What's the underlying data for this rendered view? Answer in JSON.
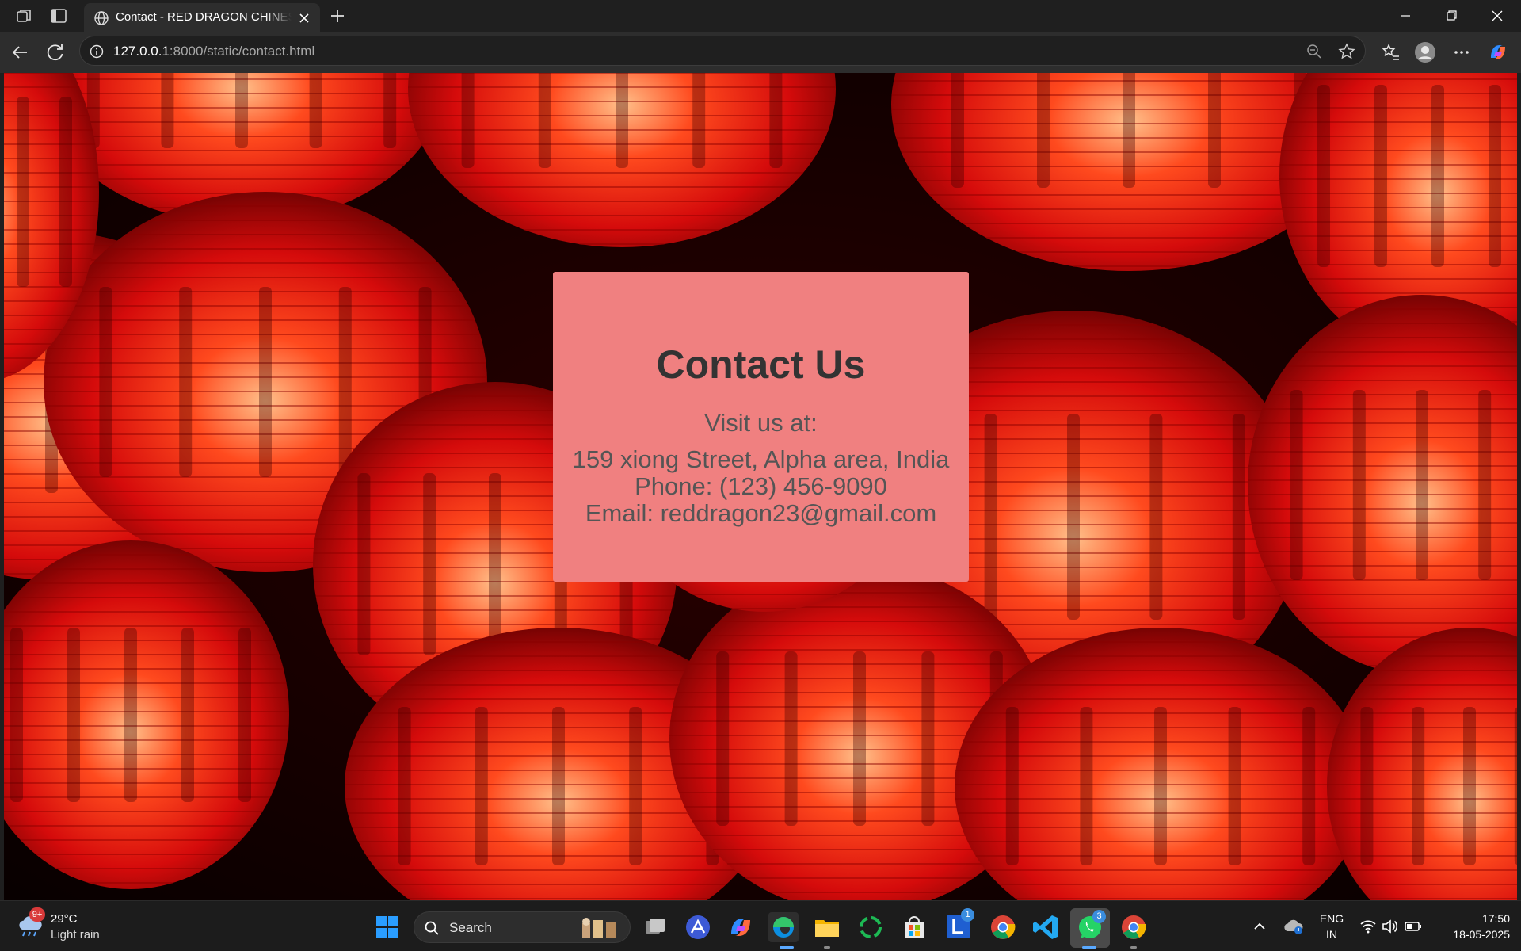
{
  "browser": {
    "tab_title": "Contact - RED DRAGON CHINESE",
    "url_host": "127.0.0.1",
    "url_path": ":8000/static/contact.html"
  },
  "page": {
    "heading": "Contact Us",
    "visit_label": "Visit us at:",
    "address": "159 xiong Street, Alpha area, India",
    "phone": "Phone: (123) 456-9090",
    "email": "Email: reddragon23@gmail.com",
    "background": "red Chinese paper lanterns",
    "card_color": "#f08080"
  },
  "taskbar": {
    "weather_badge": "9+",
    "weather_temp": "29°C",
    "weather_desc": "Light rain",
    "search_label": "Search",
    "lang_top": "ENG",
    "lang_bottom": "IN",
    "time": "17:50",
    "date": "18-05-2025",
    "badge_l": "1",
    "badge_whatsapp": "3"
  }
}
